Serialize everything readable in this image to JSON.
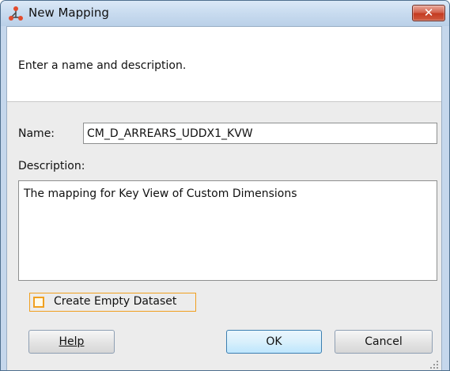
{
  "window": {
    "title": "New Mapping",
    "icon": "mapping-icon",
    "close_label": "✕"
  },
  "header": {
    "instruction": "Enter a name and description."
  },
  "form": {
    "name_label": "Name:",
    "name_value": "CM_D_ARREARS_UDDX1_KVW",
    "description_label": "Description:",
    "description_value": "The mapping for Key View of Custom Dimensions",
    "create_empty_dataset": {
      "label": "Create Empty Dataset",
      "checked": false
    }
  },
  "buttons": {
    "help": "Help",
    "ok": "OK",
    "cancel": "Cancel"
  },
  "colors": {
    "focus_accent": "#f0a020",
    "close_button": "#c43b21",
    "titlebar": "#c8dbef"
  }
}
